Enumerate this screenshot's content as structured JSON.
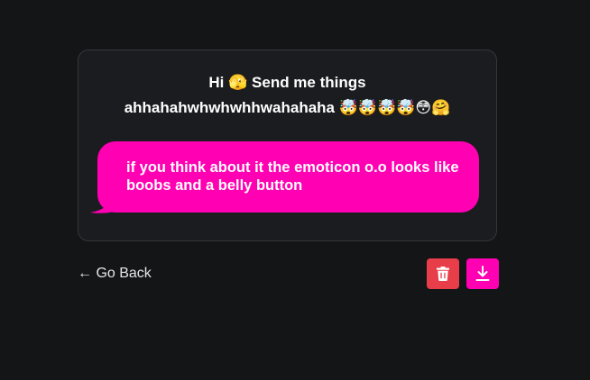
{
  "question": {
    "line1": "Hi 🫣 Send me things",
    "line2": "ahhahahwhwhwhhwahahaha 🤯🤯🤯🤯😳🤗"
  },
  "message": {
    "text": "if you think about it the emoticon o.o looks like boobs and a belly button"
  },
  "nav": {
    "back_label": "← Go Back"
  },
  "actions": {
    "delete_icon": "trash-icon",
    "download_icon": "download-icon"
  },
  "colors": {
    "background": "#141517",
    "card": "#1b1c1f",
    "bubble": "#ff00b3",
    "delete": "#e83e4a",
    "download": "#ff00b3"
  }
}
